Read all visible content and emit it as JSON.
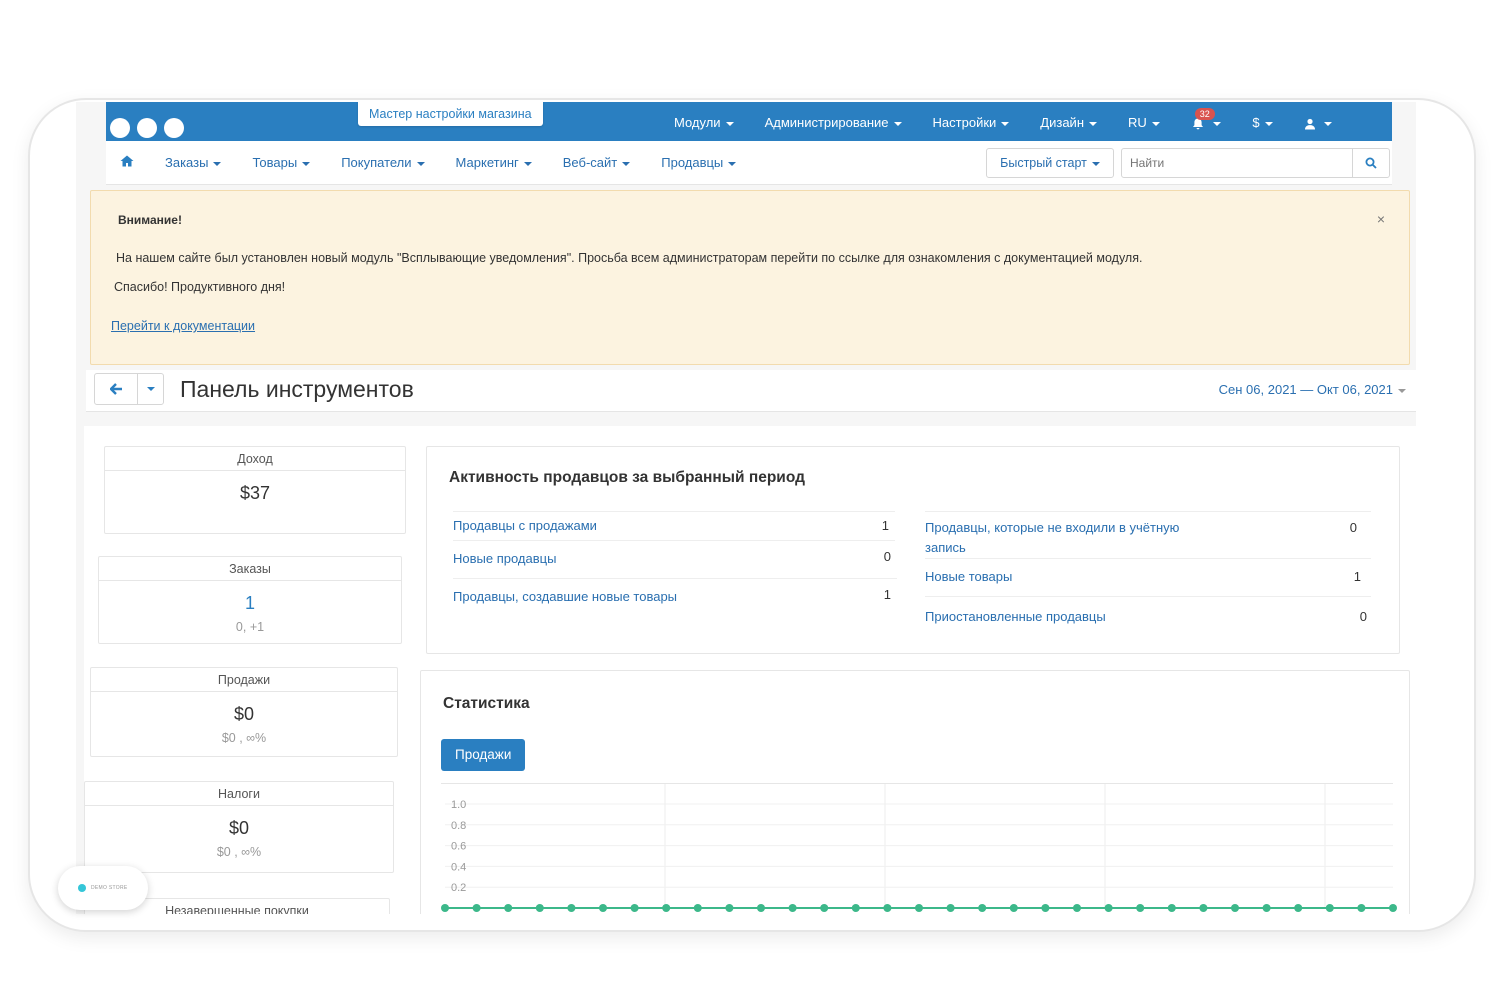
{
  "topbar": {
    "wizard": "Мастер настройки магазина",
    "menu": [
      "Модули",
      "Администрирование",
      "Настройки",
      "Дизайн",
      "RU"
    ],
    "notifications_count": "32",
    "currency": "$",
    "user_icon": "user-icon"
  },
  "nav": {
    "items": [
      "Заказы",
      "Товары",
      "Покупатели",
      "Маркетинг",
      "Веб-сайт",
      "Продавцы"
    ],
    "quick_start": "Быстрый старт",
    "search_placeholder": "Найти"
  },
  "alert": {
    "title": "Внимание!",
    "line1": "На нашем сайте был установлен новый модуль \"Всплывающие уведомления\". Просьба всем администраторам перейти по ссылке для ознакомления с документацией модуля.",
    "line2": "Спасибо! Продуктивного дня!",
    "link": "Перейти к документации",
    "close": "×"
  },
  "dashboard": {
    "title": "Панель инструментов",
    "date_range": "Сен 06, 2021 — Окт 06, 2021"
  },
  "stats": {
    "income": {
      "label": "Доход",
      "value": "$37"
    },
    "orders": {
      "label": "Заказы",
      "value": "1",
      "sub": "0, +1"
    },
    "sales": {
      "label": "Продажи",
      "value": "$0",
      "sub": "$0 , ∞%"
    },
    "taxes": {
      "label": "Налоги",
      "value": "$0",
      "sub": "$0 , ∞%"
    },
    "abandoned": {
      "label": "Незавершенные покупки"
    }
  },
  "activity": {
    "title": "Активность продавцов за выбранный период",
    "left": [
      {
        "label": "Продавцы с продажами",
        "value": "1"
      },
      {
        "label": "Новые продавцы",
        "value": "0"
      },
      {
        "label": "Продавцы, создавшие новые товары",
        "value": "1"
      }
    ],
    "right": [
      {
        "label": "Продавцы, которые не входили в учётную запись",
        "value": "0"
      },
      {
        "label": "Новые товары",
        "value": "1"
      },
      {
        "label": "Приостановленные продавцы",
        "value": "0"
      }
    ]
  },
  "statistics": {
    "title": "Статистика",
    "tab": "Продажи"
  },
  "chart_data": {
    "type": "line",
    "y_ticks": [
      "1.0",
      "0.8",
      "0.6",
      "0.4",
      "0.2"
    ],
    "ylim": [
      0,
      1
    ],
    "values": [
      0,
      0,
      0,
      0,
      0,
      0,
      0,
      0,
      0,
      0,
      0,
      0,
      0,
      0,
      0,
      0,
      0,
      0,
      0,
      0,
      0,
      0,
      0,
      0,
      0,
      0,
      0,
      0,
      0,
      0,
      0
    ],
    "color": "#3cb88a",
    "grid": true
  },
  "demo_badge": "DEMO STORE"
}
